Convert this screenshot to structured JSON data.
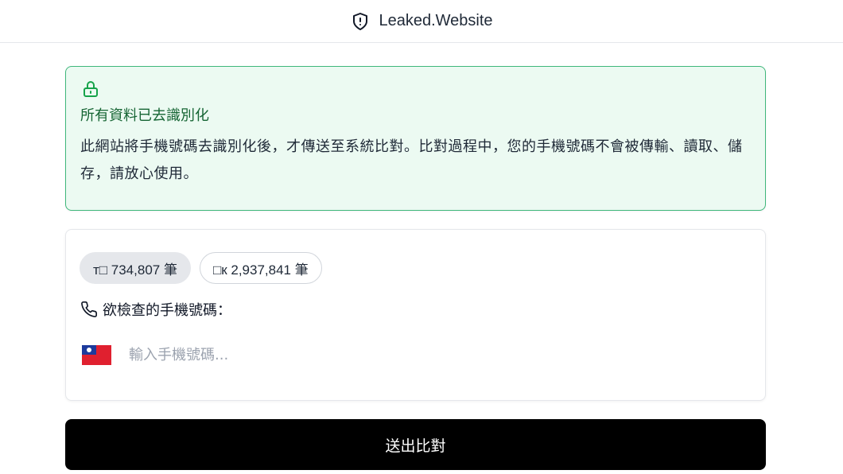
{
  "header": {
    "site_name": "Leaked.Website",
    "logo_icon": "shield-alert-icon"
  },
  "notice": {
    "icon": "lock-icon",
    "title": "所有資料已去識別化",
    "description": "此網站將手機號碼去識別化後，才傳送至系統比對。比對過程中，您的手機號碼不會被傳輸、讀取、儲存，請放心使用。",
    "colors": {
      "background": "#ecfaf2",
      "border": "#3fb77b",
      "title": "#166534"
    }
  },
  "form": {
    "chips": [
      {
        "label": "т□ 734,807 筆",
        "active": true
      },
      {
        "label": "□к 2,937,841 筆",
        "active": false
      }
    ],
    "phone_label": "欲檢查的手機號碼：",
    "phone_icon": "phone-icon",
    "country_flag": "taiwan-flag-icon",
    "phone_placeholder": "輸入手機號碼...",
    "phone_value": ""
  },
  "submit": {
    "label": "送出比對",
    "color": "#000000"
  }
}
